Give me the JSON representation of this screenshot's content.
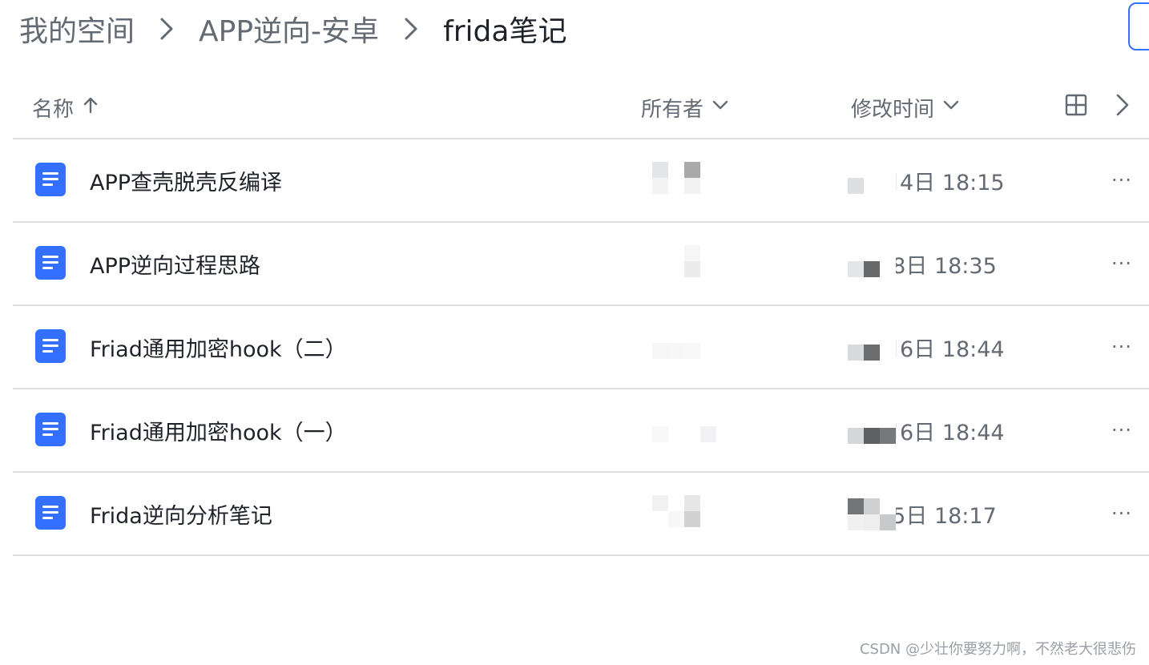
{
  "breadcrumb": {
    "items": [
      "我的空间",
      "APP逆向-安卓",
      "frida笔记"
    ]
  },
  "header": {
    "name_label": "名称",
    "owner_label": "所有者",
    "modified_label": "修改时间"
  },
  "files": [
    {
      "name": "APP查壳脱壳反编译",
      "modified": "月4日 18:15"
    },
    {
      "name": "APP逆向过程思路",
      "modified": "28日 18:35"
    },
    {
      "name": "Friad通用加密hook（二）",
      "modified": "月6日 18:44"
    },
    {
      "name": "Friad通用加密hook（一）",
      "modified": "月6日 18:44"
    },
    {
      "name": "Frida逆向分析笔记",
      "modified": "15日 18:17"
    }
  ],
  "more_label": "···",
  "watermark": "CSDN @少壮你要努力啊，不然老大很悲伤",
  "colors": {
    "accent": "#3370ff",
    "text_primary": "#1f2329",
    "text_secondary": "#646a73",
    "divider": "#dee0e3"
  },
  "icons": {
    "breadcrumb_separator": "chevron-right-icon",
    "sort": "arrow-up-icon",
    "dropdown": "chevron-down-icon",
    "grid_view": "grid-view-icon",
    "next": "chevron-right-icon",
    "file": "doc-icon"
  }
}
